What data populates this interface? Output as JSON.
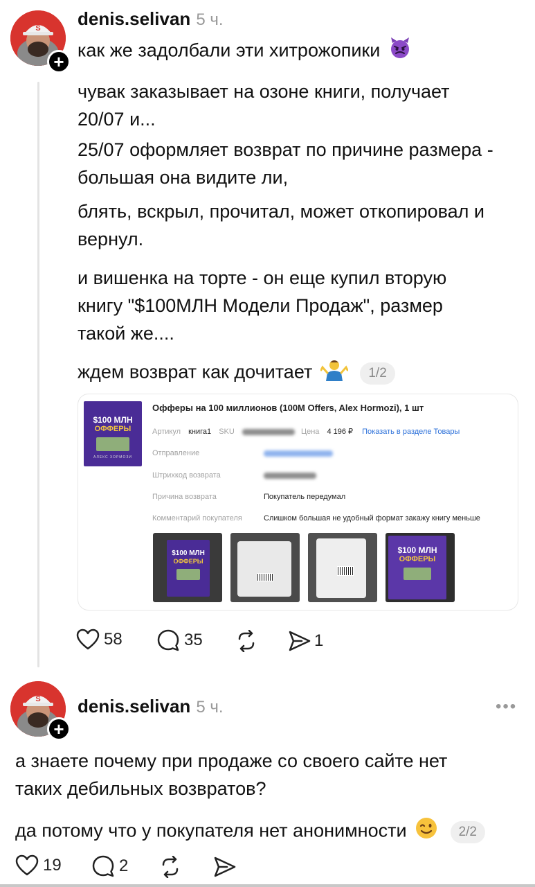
{
  "post1": {
    "username": "denis.selivan",
    "time": "5 ч.",
    "line1": "как же задолбали эти хитрожопики",
    "para1": "чувак заказывает на озоне книги, получает 20/07 и...",
    "para2": "25/07 оформляет возврат по причине размера - большая она видите ли,",
    "para3": "блять, вскрыл, прочитал, может откопировал и вернул.",
    "para4": "и вишенка на торте - он еще купил вторую книгу \"$100МЛН Модели Продаж\", размер такой же....",
    "para5": "ждем возврат как дочитает",
    "page": "1/2",
    "likes": "58",
    "comments": "35",
    "shares": "1"
  },
  "card": {
    "product_title": "Офферы на 100 миллионов (100M Offers, Alex Hormozi), 1 шт",
    "article_label": "Артикул",
    "article_value": "книга1",
    "sku_label": "SKU",
    "price_label": "Цена",
    "price_value": "4 196 ₽",
    "show_link": "Показать в разделе Товары",
    "shipment_label": "Отправление",
    "barcode_label": "Штрихкод возврата",
    "reason_label": "Причина возврата",
    "reason_value": "Покупатель передумал",
    "comment_label": "Комментарий покупателя",
    "comment_value": "Слишком большая не удобный формат закажу книгу меньше",
    "book_title_top": "$100 МЛН",
    "book_title_bottom": "ОФФЕРЫ",
    "book_author": "АЛЕКС ХОРМОЗИ"
  },
  "post2": {
    "username": "denis.selivan",
    "time": "5 ч.",
    "more": "•••",
    "para1": "а знаете почему при продаже со своего сайте нет таких дебильных возвратов?",
    "para2": "да потому что у покупателя нет анонимности",
    "page": "2/2",
    "likes": "19",
    "comments": "2"
  },
  "colors": {
    "avatar_bg": "#d8342e",
    "book_purple": "#4a2c96",
    "link_blue": "#2a6fd9",
    "badge_gray": "#efefef"
  },
  "icons": [
    "plus-icon",
    "devil-emoji",
    "shrug-emoji",
    "wink-emoji",
    "heart-icon",
    "comment-icon",
    "repost-icon",
    "share-icon",
    "more-icon"
  ]
}
